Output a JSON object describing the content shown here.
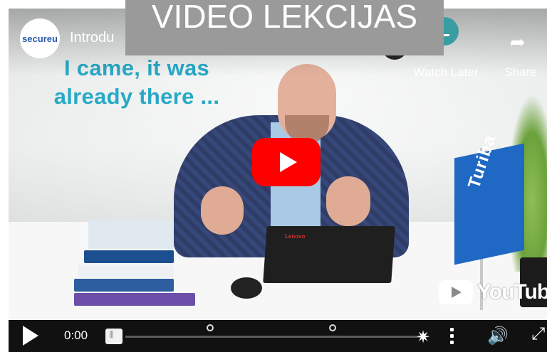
{
  "page_heading": "VIDEO LEKCIJAS",
  "player": {
    "title": "Introdu",
    "channel_logo_text": "secureu",
    "overlay_text_line1": "I came, it was",
    "overlay_text_line2": "already there ...",
    "watch_later_label": "Watch Later",
    "share_label": "Share",
    "watermark_text": "YouTube",
    "time": "0:00",
    "flag_text": "Turiba",
    "laptop_brand": "Lenovo",
    "accent_color": "#ff0000",
    "icons": [
      "play-icon",
      "share-icon",
      "clock-icon",
      "more-vert-icon",
      "volume-icon",
      "fullscreen-icon"
    ]
  }
}
